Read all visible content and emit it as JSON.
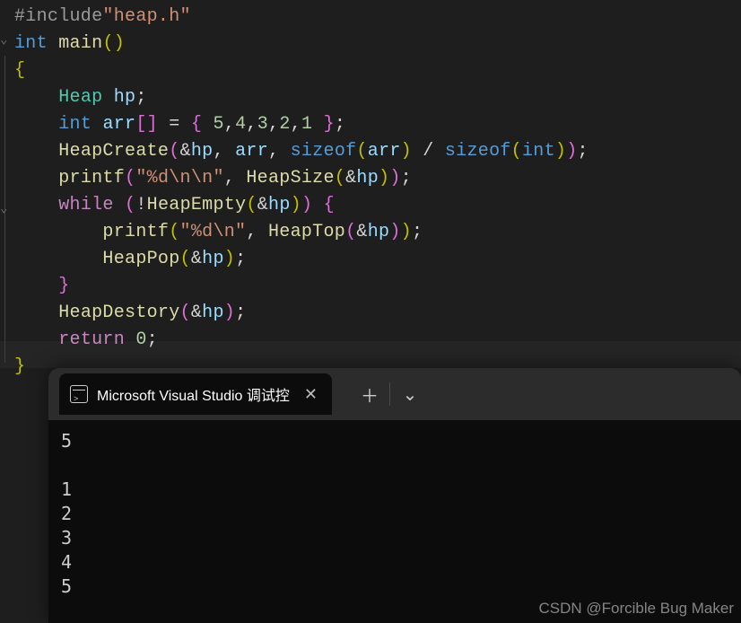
{
  "code": {
    "l1": {
      "include": "#include",
      "header": "\"heap.h\""
    },
    "l2": {
      "kw_int": "int",
      "fn": "main",
      "parens": "()"
    },
    "l3": {
      "brace": "{"
    },
    "l4": {
      "type": "Heap",
      "var": "hp",
      "semi": ";"
    },
    "l5": {
      "kw_int": "int",
      "var": "arr",
      "brk": "[]",
      "eq": " = ",
      "open": "{ ",
      "n1": "5",
      "c1": ",",
      "n2": "4",
      "c2": ",",
      "n3": "3",
      "c3": ",",
      "n4": "2",
      "c4": ",",
      "n5": "1",
      "close": " }",
      "semi": ";"
    },
    "l6": {
      "fn": "HeapCreate",
      "po": "(",
      "amp1": "&",
      "v1": "hp",
      "c1": ", ",
      "v2": "arr",
      "c2": ", ",
      "so1": "sizeof",
      "po2": "(",
      "v3": "arr",
      "pc2": ")",
      "div": " / ",
      "so2": "sizeof",
      "po3": "(",
      "t": "int",
      "pc3": ")",
      "pc": ")",
      "semi": ";"
    },
    "l7": {
      "fn": "printf",
      "po": "(",
      "str": "\"%d\\n\\n\"",
      "c": ", ",
      "fn2": "HeapSize",
      "po2": "(",
      "amp": "&",
      "v": "hp",
      "pc2": ")",
      "pc": ")",
      "semi": ";"
    },
    "l8": {
      "kw": "while",
      "sp": " ",
      "po": "(",
      "not": "!",
      "fn": "HeapEmpty",
      "po2": "(",
      "amp": "&",
      "v": "hp",
      "pc2": ")",
      "pc": ")",
      "sp2": " ",
      "brace": "{"
    },
    "l9": {
      "fn": "printf",
      "po": "(",
      "str": "\"%d\\n\"",
      "c": ", ",
      "fn2": "HeapTop",
      "po2": "(",
      "amp": "&",
      "v": "hp",
      "pc2": ")",
      "pc": ")",
      "semi": ";"
    },
    "l10": {
      "fn": "HeapPop",
      "po": "(",
      "amp": "&",
      "v": "hp",
      "pc": ")",
      "semi": ";"
    },
    "l11": {
      "brace": "}"
    },
    "l12": {
      "fn": "HeapDestory",
      "po": "(",
      "amp": "&",
      "v": "hp",
      "pc": ")",
      "semi": ";"
    },
    "l13": {
      "kw": "return",
      "sp": " ",
      "n": "0",
      "semi": ";"
    },
    "l14": {
      "brace": "}"
    }
  },
  "terminal": {
    "tab_title": "Microsoft Visual Studio 调试控",
    "output": [
      "5",
      "",
      "1",
      "2",
      "3",
      "4",
      "5"
    ]
  },
  "watermark": "CSDN @Forcible Bug Maker",
  "icons": {
    "plus": "＋",
    "chevron": "⌄",
    "close": "✕"
  }
}
